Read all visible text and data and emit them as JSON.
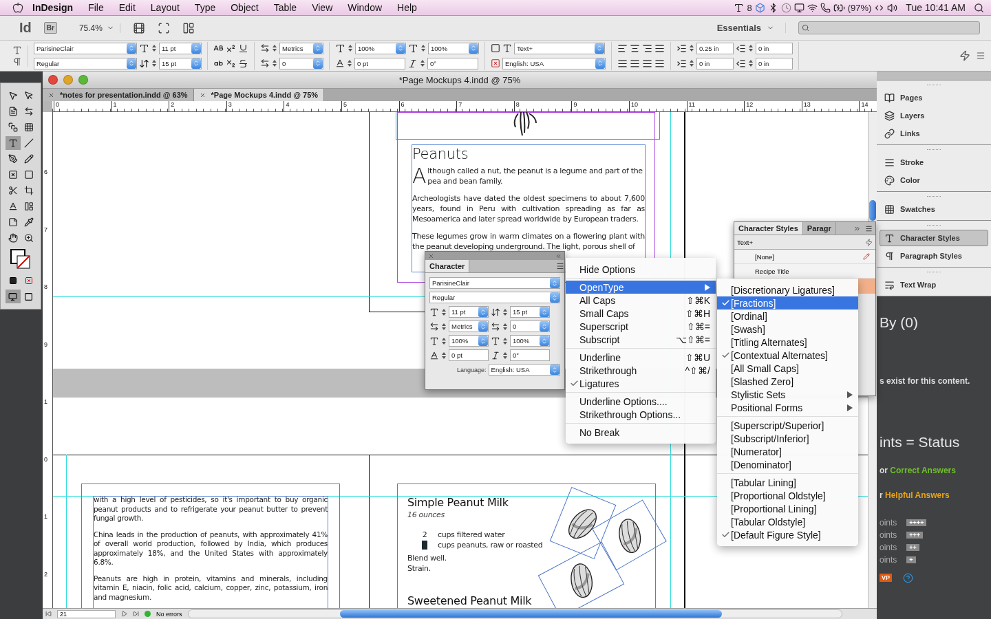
{
  "menubar": {
    "app_name": "InDesign",
    "menus": [
      "File",
      "Edit",
      "Layout",
      "Type",
      "Object",
      "Table",
      "View",
      "Window",
      "Help"
    ],
    "adobe_count": "8",
    "battery": "(97%)",
    "clock": "Tue 10:41 AM"
  },
  "app_bar": {
    "logo": "Id",
    "bridge": "Br",
    "zoom": "75.4%",
    "workspace": "Essentials"
  },
  "control_panel": {
    "font": "ParisineClair",
    "style": "Regular",
    "size": "11 pt",
    "leading": "15 pt",
    "kerning": "Metrics",
    "tracking": "0",
    "vscale": "100%",
    "hscale": "100%",
    "baseline": "0 pt",
    "skew": "0°",
    "char_style": "Text+",
    "language": "English: USA",
    "left_indent": "0.25 in",
    "first_indent": "0 in",
    "right_indent": "0 in",
    "last_indent": "0 in"
  },
  "document": {
    "title": "*Page Mockups 4.indd @ 75%",
    "tabs": [
      {
        "label": "*notes for presentation.indd @ 63%",
        "selected": false
      },
      {
        "label": "*Page Mockups 4.indd @ 75%",
        "selected": true
      }
    ],
    "ruler_h": [
      "0",
      "1",
      "2",
      "3",
      "4",
      "5",
      "6",
      "7",
      "8",
      "9",
      "10",
      "11",
      "12",
      "13",
      "14"
    ],
    "ruler_v": [
      "6",
      "7",
      "8",
      "9",
      "1",
      "0",
      "1",
      "2"
    ],
    "article": {
      "heading": "Peanuts",
      "drop_cap": "A",
      "lead": "lthough called a nut, the peanut is a legume and part of the pea and bean family.",
      "paragraphs": [
        "Archeologists have dated the oldest specimens to about 7,600 years, found in Peru with cultivation spreading as far as Mesoamerica and later spread worldwide by European traders.",
        "These legumes grow in warm climates on a flowering plant with the peanut developing underground. The light, porous shell of"
      ]
    },
    "left_column": [
      "with a high level of pesticides, so it's important to buy organic peanut products and to refrigerate your peanut butter to prevent fungal growth.",
      "China leads in the production of peanuts, with approximately 41% of overall world production, followed by India, which produces approximately 18%, and  the United States with approximately 6.8%.",
      "Peanuts are high in protein, vitamins and minerals, including vitamin E, niacin, folic acid, calcium, copper, zinc, potassium, iron and magnesium."
    ],
    "recipe": {
      "title": "Simple Peanut Milk",
      "yield": "16 ounces",
      "ingredients": [
        {
          "qty": "2",
          "text": "cups filtered water",
          "selected": false
        },
        {
          "text": "cups peanuts, raw or roasted",
          "selected": true
        }
      ],
      "steps": [
        "Blend well.",
        "Strain."
      ],
      "next_title": "Sweetened Peanut Milk"
    },
    "status": {
      "page": "21",
      "preflight": "No errors"
    }
  },
  "character_panel": {
    "title": "Character",
    "font": "ParisineClair",
    "style": "Regular",
    "size": "11 pt",
    "leading": "15 pt",
    "kerning": "Metrics",
    "tracking": "0",
    "vscale": "100%",
    "hscale": "100%",
    "baseline": "0 pt",
    "skew": "0°",
    "language_label": "Language:",
    "language": "English: USA"
  },
  "context_menu": {
    "groups": [
      [
        {
          "label": "Hide Options",
          "checked": false,
          "selected": false,
          "submenu": false
        }
      ],
      [
        {
          "label": "OpenType",
          "checked": false,
          "selected": true,
          "submenu": true
        },
        {
          "label": "All Caps",
          "shortcut": "⇧⌘K",
          "checked": false,
          "selected": false,
          "submenu": false
        },
        {
          "label": "Small Caps",
          "shortcut": "⇧⌘H",
          "checked": false,
          "selected": false,
          "submenu": false
        },
        {
          "label": "Superscript",
          "shortcut": "⇧⌘=",
          "checked": false,
          "selected": false,
          "submenu": false
        },
        {
          "label": "Subscript",
          "shortcut": "⌥⇧⌘=",
          "checked": false,
          "selected": false,
          "submenu": false
        }
      ],
      [
        {
          "label": "Underline",
          "shortcut": "⇧⌘U",
          "checked": false,
          "selected": false,
          "submenu": false
        },
        {
          "label": "Strikethrough",
          "shortcut": "^⇧⌘/",
          "checked": false,
          "selected": false,
          "submenu": false
        },
        {
          "label": "Ligatures",
          "checked": true,
          "selected": false,
          "submenu": false
        }
      ],
      [
        {
          "label": "Underline Options....",
          "checked": false,
          "selected": false,
          "submenu": false
        },
        {
          "label": "Strikethrough Options...",
          "checked": false,
          "selected": false,
          "submenu": false
        }
      ],
      [
        {
          "label": "No Break",
          "checked": false,
          "selected": false,
          "submenu": false
        }
      ]
    ]
  },
  "opentype_menu": {
    "groups": [
      [
        {
          "label": "[Discretionary Ligatures]",
          "checked": false,
          "selected": false,
          "submenu": false
        },
        {
          "label": "[Fractions]",
          "checked": true,
          "selected": true,
          "submenu": false
        },
        {
          "label": "[Ordinal]",
          "checked": false,
          "selected": false,
          "submenu": false
        },
        {
          "label": "[Swash]",
          "checked": false,
          "selected": false,
          "submenu": false
        },
        {
          "label": "[Titling Alternates]",
          "checked": false,
          "selected": false,
          "submenu": false
        },
        {
          "label": "[Contextual Alternates]",
          "checked": true,
          "selected": false,
          "submenu": false
        },
        {
          "label": "[All Small Caps]",
          "checked": false,
          "selected": false,
          "submenu": false
        },
        {
          "label": "[Slashed Zero]",
          "checked": false,
          "selected": false,
          "submenu": false
        },
        {
          "label": "Stylistic Sets",
          "checked": false,
          "selected": false,
          "submenu": true
        },
        {
          "label": "Positional Forms",
          "checked": false,
          "selected": false,
          "submenu": true
        }
      ],
      [
        {
          "label": "[Superscript/Superior]",
          "checked": false,
          "selected": false,
          "submenu": false
        },
        {
          "label": "[Subscript/Inferior]",
          "checked": false,
          "selected": false,
          "submenu": false
        },
        {
          "label": "[Numerator]",
          "checked": false,
          "selected": false,
          "submenu": false
        },
        {
          "label": "[Denominator]",
          "checked": false,
          "selected": false,
          "submenu": false
        }
      ],
      [
        {
          "label": "[Tabular Lining]",
          "checked": false,
          "selected": false,
          "submenu": false
        },
        {
          "label": "[Proportional Oldstyle]",
          "checked": false,
          "selected": false,
          "submenu": false
        },
        {
          "label": "[Proportional Lining]",
          "checked": false,
          "selected": false,
          "submenu": false
        },
        {
          "label": "[Tabular Oldstyle]",
          "checked": false,
          "selected": false,
          "submenu": false
        },
        {
          "label": "[Default Figure Style]",
          "checked": true,
          "selected": false,
          "submenu": false
        }
      ]
    ]
  },
  "styles_panel": {
    "tabs": [
      {
        "label": "Character Styles",
        "selected": true
      },
      {
        "label": "Paragr",
        "selected": false
      }
    ],
    "current": "Text+",
    "items": [
      {
        "label": "[None]",
        "selected": false
      },
      {
        "label": "Recipe Title",
        "selected": false
      }
    ]
  },
  "dock": {
    "groups": [
      [
        {
          "label": "Pages",
          "selected": false
        },
        {
          "label": "Layers",
          "selected": false
        },
        {
          "label": "Links",
          "selected": false
        }
      ],
      [
        {
          "label": "Stroke",
          "selected": false
        },
        {
          "label": "Color",
          "selected": false
        }
      ],
      [
        {
          "label": "Swatches",
          "selected": false
        }
      ],
      [
        {
          "label": "Character Styles",
          "selected": true
        },
        {
          "label": "Paragraph Styles",
          "selected": false
        }
      ],
      [
        {
          "label": "Text Wrap",
          "selected": false
        }
      ]
    ]
  },
  "background_page": {
    "heading": "By (0)",
    "notice": "s exist for this content.",
    "status_heading": "ints = Status",
    "legend": [
      {
        "prefix": "or",
        "label": "Correct Answers",
        "color": "#6fbf2a"
      },
      {
        "prefix": "r",
        "label": "Helpful Answers",
        "color": "#e8a317"
      }
    ],
    "levels": [
      {
        "label": "oints",
        "badge": "++++"
      },
      {
        "label": "oints",
        "badge": "+++"
      },
      {
        "label": "oints",
        "badge": "++"
      },
      {
        "label": "oints",
        "badge": "+"
      }
    ],
    "mvp": "VP"
  }
}
